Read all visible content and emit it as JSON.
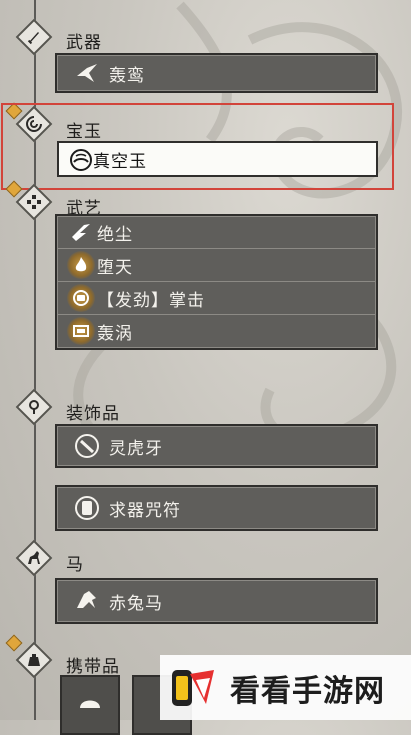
{
  "categories": [
    {
      "label": "武器",
      "icon": "sword-icon",
      "items": [
        {
          "label": "轰鸾",
          "icon": "spin-blade-icon"
        }
      ]
    },
    {
      "label": "宝玉",
      "icon": "jade-swirl-icon",
      "items": [
        {
          "label": "真空玉",
          "icon": "vacuum-orb-icon"
        }
      ],
      "selected": true
    },
    {
      "label": "武艺",
      "icon": "martial-icon",
      "items": [
        {
          "label": "绝尘",
          "icon": "dash-icon"
        },
        {
          "label": "堕天",
          "icon": "flame-icon"
        },
        {
          "label": "【发劲】掌击",
          "icon": "fist-icon"
        },
        {
          "label": "轰涡",
          "icon": "vortex-icon"
        }
      ]
    },
    {
      "label": "装饰品",
      "icon": "ornament-icon",
      "items": [
        {
          "label": "灵虎牙",
          "icon": "tiger-fang-icon"
        },
        {
          "label": "求器咒符",
          "icon": "talisman-icon"
        }
      ]
    },
    {
      "label": "马",
      "icon": "horse-icon",
      "items": [
        {
          "label": "赤兔马",
          "icon": "red-hare-icon"
        }
      ]
    },
    {
      "label": "携带品",
      "icon": "pouch-icon",
      "items": []
    }
  ],
  "watermark": {
    "text": "看看手游网",
    "logo": "kk-logo-icon"
  },
  "colors": {
    "highlight": "#d2443a",
    "gem": "#e0a63b",
    "slot": "#5f5e5b"
  }
}
